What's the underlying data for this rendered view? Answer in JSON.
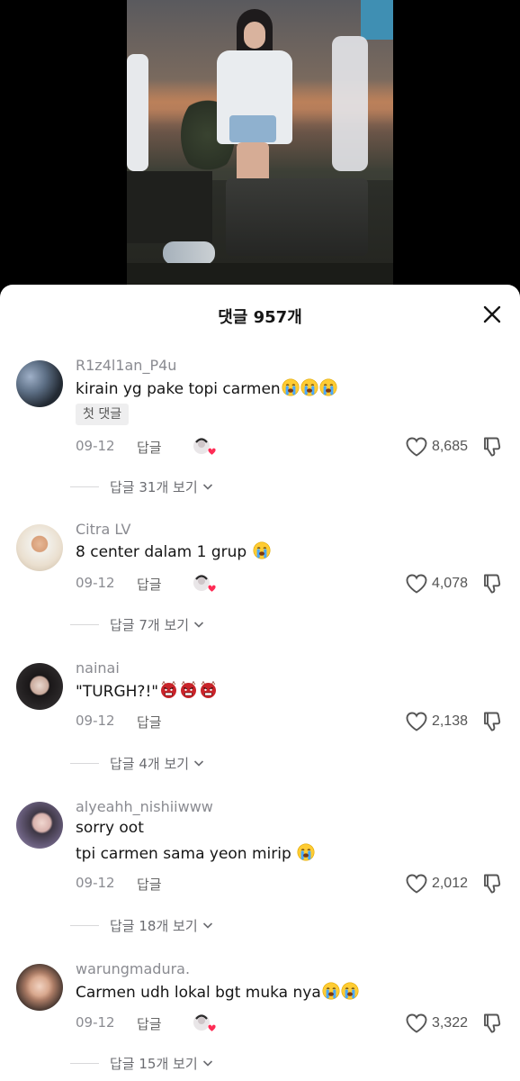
{
  "sheet": {
    "title": "댓글 957개"
  },
  "comments": [
    {
      "username": "R1z4l1an_P4u",
      "lines": [
        {
          "text": "kirain yg pake topi carmen",
          "emoji": [
            "crying-face",
            "crying-face",
            "crying-face"
          ]
        }
      ],
      "badge": "첫 댓글",
      "date": "09-12",
      "reply_label": "답글",
      "creator_liked": true,
      "likes": "8,685",
      "view_replies": "답글 31개 보기"
    },
    {
      "username": "Citra LV",
      "lines": [
        {
          "text": "8 center dalam 1 grup ",
          "emoji": [
            "crying-face"
          ]
        }
      ],
      "date": "09-12",
      "reply_label": "답글",
      "creator_liked": true,
      "likes": "4,078",
      "view_replies": "답글 7개 보기"
    },
    {
      "username": "nainai",
      "lines": [
        {
          "text": "\"TURGH?!\"",
          "emoji": [
            "ogre-face",
            "ogre-face",
            "ogre-face"
          ]
        }
      ],
      "date": "09-12",
      "reply_label": "답글",
      "creator_liked": false,
      "likes": "2,138",
      "view_replies": "답글 4개 보기"
    },
    {
      "username": "alyeahh_nishiiwww",
      "lines": [
        {
          "text": "sorry oot",
          "emoji": []
        },
        {
          "text": "tpi carmen sama yeon mirip ",
          "emoji": [
            "crying-face"
          ]
        }
      ],
      "date": "09-12",
      "reply_label": "답글",
      "creator_liked": false,
      "likes": "2,012",
      "view_replies": "답글 18개 보기"
    },
    {
      "username": "warungmadura.",
      "lines": [
        {
          "text": "Carmen udh lokal bgt muka nya",
          "emoji": [
            "crying-face",
            "crying-face"
          ]
        }
      ],
      "date": "09-12",
      "reply_label": "답글",
      "creator_liked": true,
      "likes": "3,322",
      "view_replies": "답글 15개 보기"
    }
  ],
  "icons": {
    "close": "close-icon",
    "like": "heart-outline-icon",
    "dislike": "thumbs-down-outline-icon",
    "chevron": "chevron-down-icon",
    "creator_like": "creator-avatar-with-heart-icon"
  },
  "colors": {
    "sheet_bg": "#ffffff",
    "text_primary": "#161616",
    "text_secondary": "#8a8b91",
    "creator_heart": "#fe2c55"
  }
}
